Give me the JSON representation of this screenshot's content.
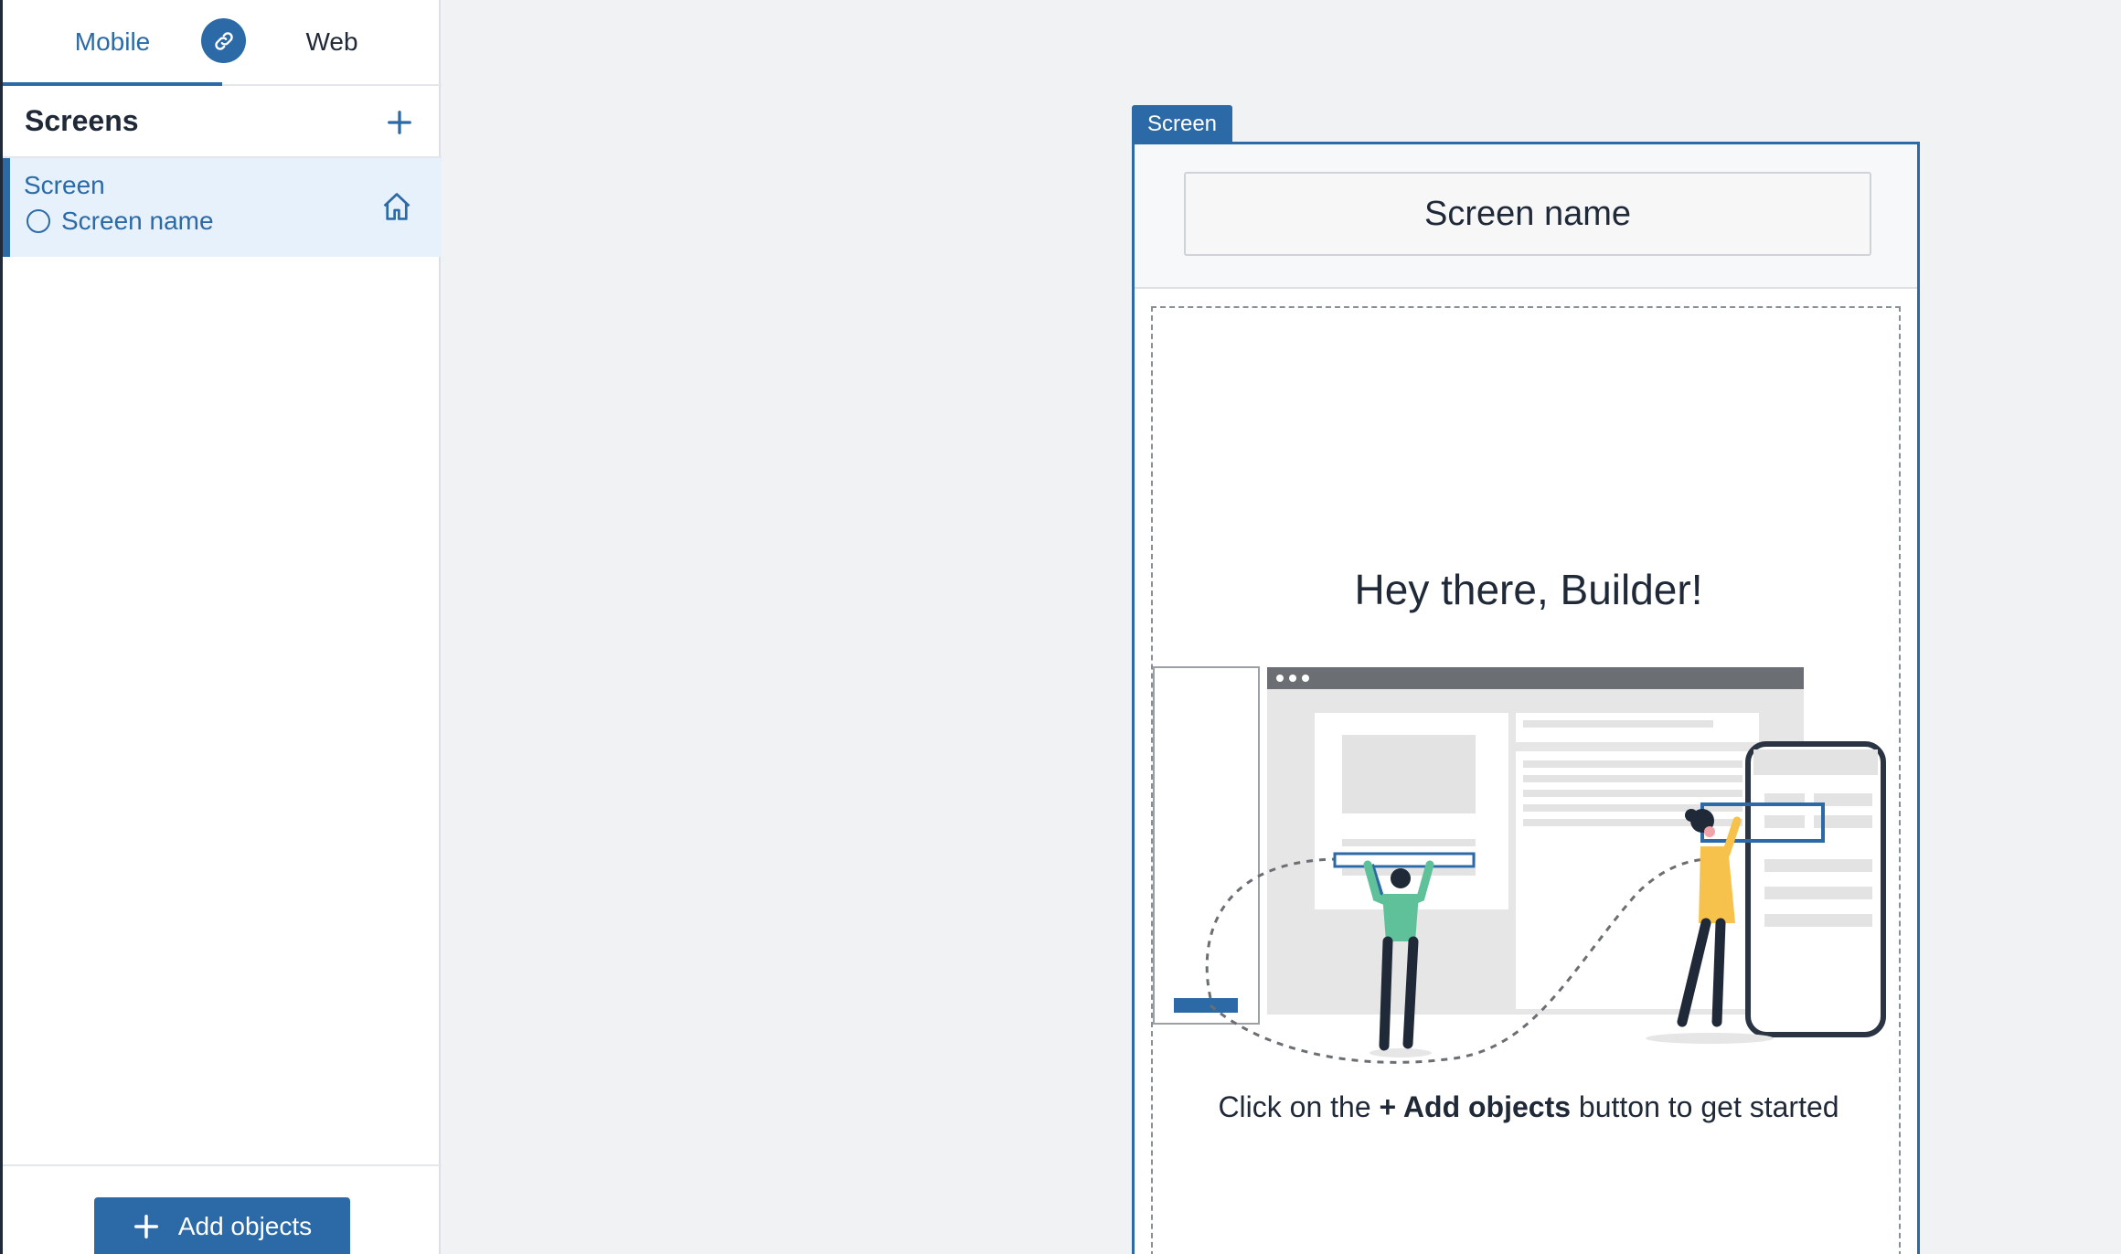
{
  "tabs": {
    "mobile": "Mobile",
    "web": "Web"
  },
  "screens_panel": {
    "title": "Screens",
    "items": [
      {
        "label": "Screen",
        "sub_label": "Screen name"
      }
    ]
  },
  "footer": {
    "add_objects_label": "Add objects"
  },
  "canvas": {
    "screen_tag": "Screen",
    "screen_name": "Screen name",
    "greeting": "Hey there, Builder!",
    "hint_prefix": "Click on the ",
    "hint_bold": "+ Add objects",
    "hint_suffix": " button to get started"
  },
  "colors": {
    "accent": "#2b6aa6",
    "active_item_bg": "#e7f1fb",
    "canvas_bg": "#f1f2f4"
  },
  "icons": [
    "link-icon",
    "plus-icon",
    "circle-icon",
    "home-icon"
  ]
}
